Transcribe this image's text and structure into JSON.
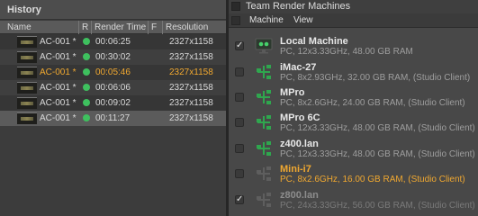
{
  "history": {
    "title": "History",
    "columns": {
      "name": "Name",
      "r": "R",
      "render_time": "Render Time",
      "f": "F",
      "resolution": "Resolution"
    },
    "rows": [
      {
        "name": "AC-001 *",
        "time": "00:06:25",
        "res": "2327x1158",
        "state": "normal"
      },
      {
        "name": "AC-001 *",
        "time": "00:30:02",
        "res": "2327x1158",
        "state": "normal"
      },
      {
        "name": "AC-001 *",
        "time": "00:05:46",
        "res": "2327x1158",
        "state": "active"
      },
      {
        "name": "AC-001 *",
        "time": "00:06:06",
        "res": "2327x1158",
        "state": "normal"
      },
      {
        "name": "AC-001 *",
        "time": "00:09:02",
        "res": "2327x1158",
        "state": "normal"
      },
      {
        "name": "AC-001 *",
        "time": "00:11:27",
        "res": "2327x1158",
        "state": "selected"
      }
    ]
  },
  "team_render": {
    "title": "Team Render Machines",
    "menu": {
      "machine": "Machine",
      "view": "View"
    },
    "machines": [
      {
        "name": "Local Machine",
        "desc": "PC, 12x3.33GHz, 48.00 GB RAM",
        "checked": true,
        "icon": "local-monitor-icon",
        "state": "normal"
      },
      {
        "name": "iMac-27",
        "desc": "PC, 8x2.93GHz, 32.00 GB RAM, (Studio Client)",
        "checked": false,
        "icon": "network-client-icon",
        "state": "normal"
      },
      {
        "name": "MPro",
        "desc": "PC, 8x2.6GHz, 24.00 GB RAM, (Studio Client)",
        "checked": false,
        "icon": "network-client-icon",
        "state": "normal"
      },
      {
        "name": "MPro 6C",
        "desc": "PC, 12x3.33GHz, 48.00 GB RAM, (Studio Client)",
        "checked": false,
        "icon": "network-client-icon",
        "state": "normal"
      },
      {
        "name": "z400.lan",
        "desc": "PC, 12x3.33GHz, 48.00 GB RAM, (Studio Client)",
        "checked": false,
        "icon": "network-client-icon",
        "state": "normal"
      },
      {
        "name": "Mini-i7",
        "desc": "PC, 8x2.6GHz, 16.00 GB RAM, (Studio Client)",
        "checked": false,
        "icon": "network-client-idle-icon",
        "state": "highlight"
      },
      {
        "name": "z800.lan",
        "desc": "PC, 24x3.33GHz, 56.00 GB RAM, (Studio Client)",
        "checked": true,
        "icon": "network-client-idle-icon",
        "state": "faded"
      }
    ],
    "colors": {
      "status_green": "#3ec05e",
      "highlight_orange": "#f0a830"
    }
  }
}
